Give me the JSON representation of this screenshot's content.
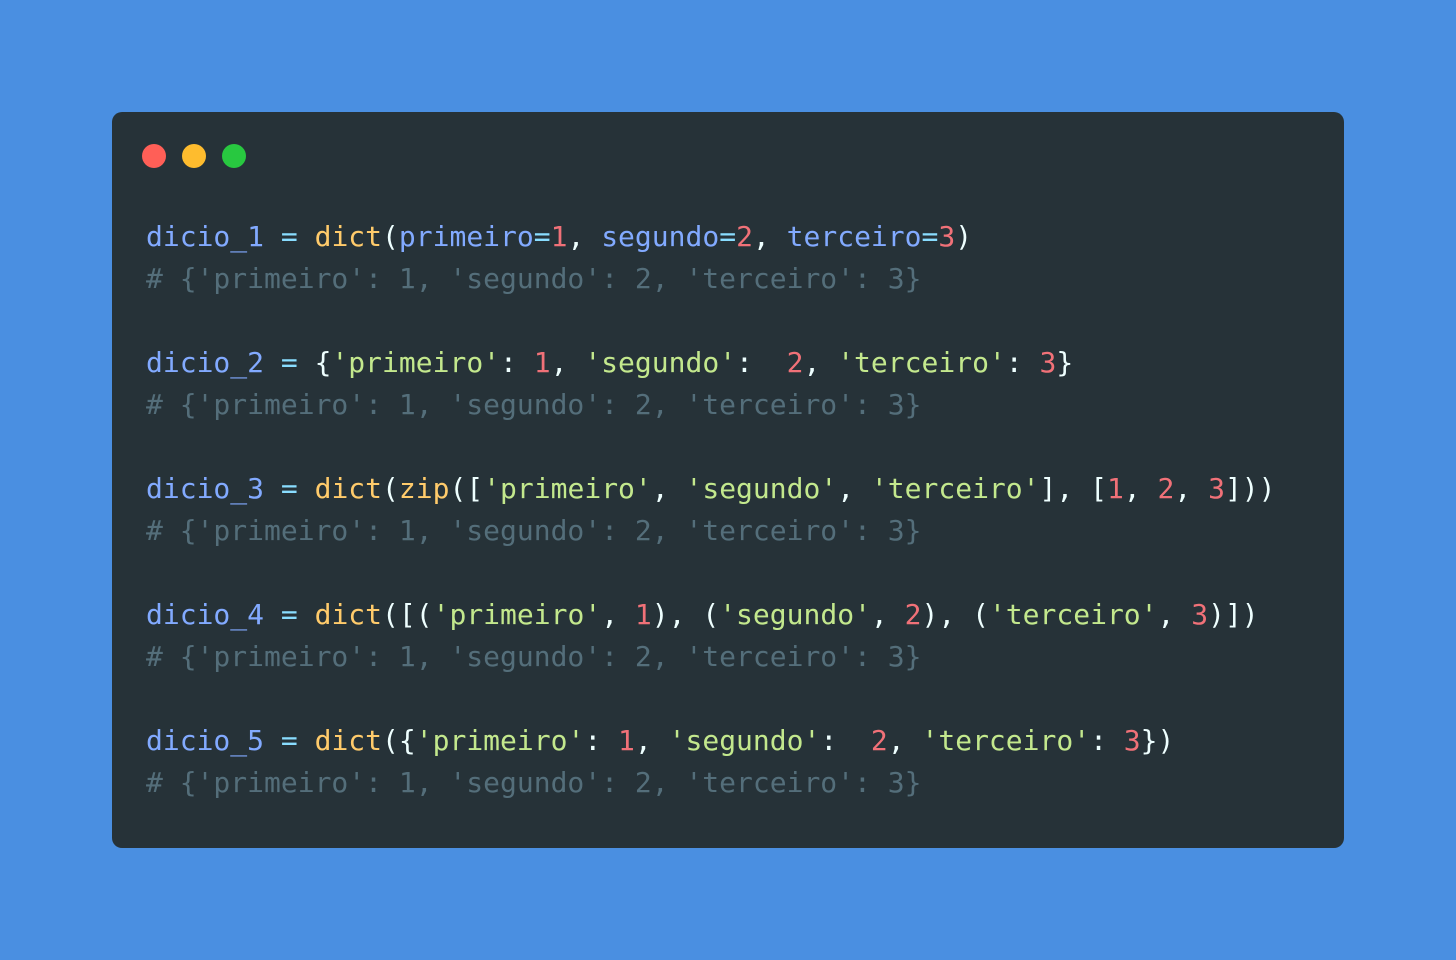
{
  "window": {
    "traffic_lights": [
      {
        "name": "close",
        "color": "#ff5f57"
      },
      {
        "name": "minimize",
        "color": "#febc2e"
      },
      {
        "name": "maximize",
        "color": "#28c840"
      }
    ]
  },
  "code": {
    "language": "python",
    "lines": [
      [
        [
          "v",
          "dicio_1"
        ],
        [
          "p",
          " "
        ],
        [
          "o",
          "="
        ],
        [
          "p",
          " "
        ],
        [
          "f",
          "dict"
        ],
        [
          "p",
          "("
        ],
        [
          "v",
          "primeiro"
        ],
        [
          "o",
          "="
        ],
        [
          "n",
          "1"
        ],
        [
          "p",
          ", "
        ],
        [
          "v",
          "segundo"
        ],
        [
          "o",
          "="
        ],
        [
          "n",
          "2"
        ],
        [
          "p",
          ", "
        ],
        [
          "v",
          "terceiro"
        ],
        [
          "o",
          "="
        ],
        [
          "n",
          "3"
        ],
        [
          "p",
          ")"
        ]
      ],
      [
        [
          "c",
          "# {'primeiro': 1, 'segundo': 2, 'terceiro': 3}"
        ]
      ],
      [],
      [
        [
          "v",
          "dicio_2"
        ],
        [
          "p",
          " "
        ],
        [
          "o",
          "="
        ],
        [
          "p",
          " {"
        ],
        [
          "s",
          "'primeiro'"
        ],
        [
          "p",
          ": "
        ],
        [
          "n",
          "1"
        ],
        [
          "p",
          ", "
        ],
        [
          "s",
          "'segundo'"
        ],
        [
          "p",
          ":  "
        ],
        [
          "n",
          "2"
        ],
        [
          "p",
          ", "
        ],
        [
          "s",
          "'terceiro'"
        ],
        [
          "p",
          ": "
        ],
        [
          "n",
          "3"
        ],
        [
          "p",
          "}"
        ]
      ],
      [
        [
          "c",
          "# {'primeiro': 1, 'segundo': 2, 'terceiro': 3}"
        ]
      ],
      [],
      [
        [
          "v",
          "dicio_3"
        ],
        [
          "p",
          " "
        ],
        [
          "o",
          "="
        ],
        [
          "p",
          " "
        ],
        [
          "f",
          "dict"
        ],
        [
          "p",
          "("
        ],
        [
          "f",
          "zip"
        ],
        [
          "p",
          "(["
        ],
        [
          "s",
          "'primeiro'"
        ],
        [
          "p",
          ", "
        ],
        [
          "s",
          "'segundo'"
        ],
        [
          "p",
          ", "
        ],
        [
          "s",
          "'terceiro'"
        ],
        [
          "p",
          "], ["
        ],
        [
          "n",
          "1"
        ],
        [
          "p",
          ", "
        ],
        [
          "n",
          "2"
        ],
        [
          "p",
          ", "
        ],
        [
          "n",
          "3"
        ],
        [
          "p",
          "]))"
        ]
      ],
      [
        [
          "c",
          "# {'primeiro': 1, 'segundo': 2, 'terceiro': 3}"
        ]
      ],
      [],
      [
        [
          "v",
          "dicio_4"
        ],
        [
          "p",
          " "
        ],
        [
          "o",
          "="
        ],
        [
          "p",
          " "
        ],
        [
          "f",
          "dict"
        ],
        [
          "p",
          "([("
        ],
        [
          "s",
          "'primeiro'"
        ],
        [
          "p",
          ", "
        ],
        [
          "n",
          "1"
        ],
        [
          "p",
          "), ("
        ],
        [
          "s",
          "'segundo'"
        ],
        [
          "p",
          ", "
        ],
        [
          "n",
          "2"
        ],
        [
          "p",
          "), ("
        ],
        [
          "s",
          "'terceiro'"
        ],
        [
          "p",
          ", "
        ],
        [
          "n",
          "3"
        ],
        [
          "p",
          ")])"
        ]
      ],
      [
        [
          "c",
          "# {'primeiro': 1, 'segundo': 2, 'terceiro': 3}"
        ]
      ],
      [],
      [
        [
          "v",
          "dicio_5"
        ],
        [
          "p",
          " "
        ],
        [
          "o",
          "="
        ],
        [
          "p",
          " "
        ],
        [
          "f",
          "dict"
        ],
        [
          "p",
          "({"
        ],
        [
          "s",
          "'primeiro'"
        ],
        [
          "p",
          ": "
        ],
        [
          "n",
          "1"
        ],
        [
          "p",
          ", "
        ],
        [
          "s",
          "'segundo'"
        ],
        [
          "p",
          ":  "
        ],
        [
          "n",
          "2"
        ],
        [
          "p",
          ", "
        ],
        [
          "s",
          "'terceiro'"
        ],
        [
          "p",
          ": "
        ],
        [
          "n",
          "3"
        ],
        [
          "p",
          "})"
        ]
      ],
      [
        [
          "c",
          "# {'primeiro': 1, 'segundo': 2, 'terceiro': 3}"
        ]
      ]
    ]
  }
}
